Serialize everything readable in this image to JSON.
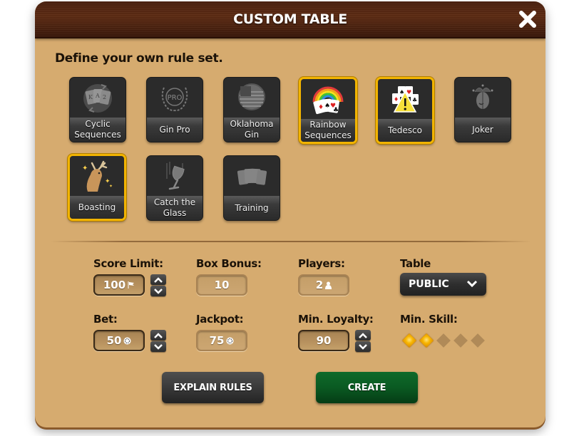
{
  "header": {
    "title": "CUSTOM TABLE",
    "close_icon": "close-icon"
  },
  "subtitle": "Define your own rule set.",
  "rule_tiles": [
    {
      "label": "Cyclic Sequences",
      "icon": "cyclic-cards-icon",
      "selected": false
    },
    {
      "label": "Gin Pro",
      "icon": "pro-laurel-icon",
      "selected": false
    },
    {
      "label": "Oklahoma Gin",
      "icon": "us-flag-icon",
      "selected": false
    },
    {
      "label": "Rainbow Sequences",
      "icon": "rainbow-cards-icon",
      "selected": true
    },
    {
      "label": "Tedesco",
      "icon": "aces-warning-icon",
      "selected": true
    },
    {
      "label": "Joker",
      "icon": "jester-icon",
      "selected": false
    },
    {
      "label": "Boasting",
      "icon": "deer-icon",
      "selected": true
    },
    {
      "label": "Catch the Glass",
      "icon": "falling-glass-icon",
      "selected": false
    },
    {
      "label": "Training",
      "icon": "cards-fan-icon",
      "selected": false
    }
  ],
  "settings": {
    "score_limit": {
      "label": "Score Limit:",
      "value": "100",
      "unit_icon": "flag-icon"
    },
    "box_bonus": {
      "label": "Box Bonus:",
      "value": "10"
    },
    "players": {
      "label": "Players:",
      "value": "2",
      "unit_icon": "person-icon"
    },
    "table": {
      "label": "Table",
      "value": "PUBLIC"
    },
    "bet": {
      "label": "Bet:",
      "value": "50",
      "unit_icon": "chip-icon"
    },
    "jackpot": {
      "label": "Jackpot:",
      "value": "75",
      "unit_icon": "chip-icon"
    },
    "min_loyalty": {
      "label": "Min. Loyalty:",
      "value": "90"
    },
    "min_skill": {
      "label": "Min. Skill:",
      "value": 2,
      "max": 5
    }
  },
  "buttons": {
    "explain_rules": "EXPLAIN RULES",
    "create": "CREATE"
  },
  "colors": {
    "selected_border": "#f2b400",
    "panel": "#d6ab6f",
    "create_green": "#0a5a22",
    "header_wood": "#4a2110"
  }
}
